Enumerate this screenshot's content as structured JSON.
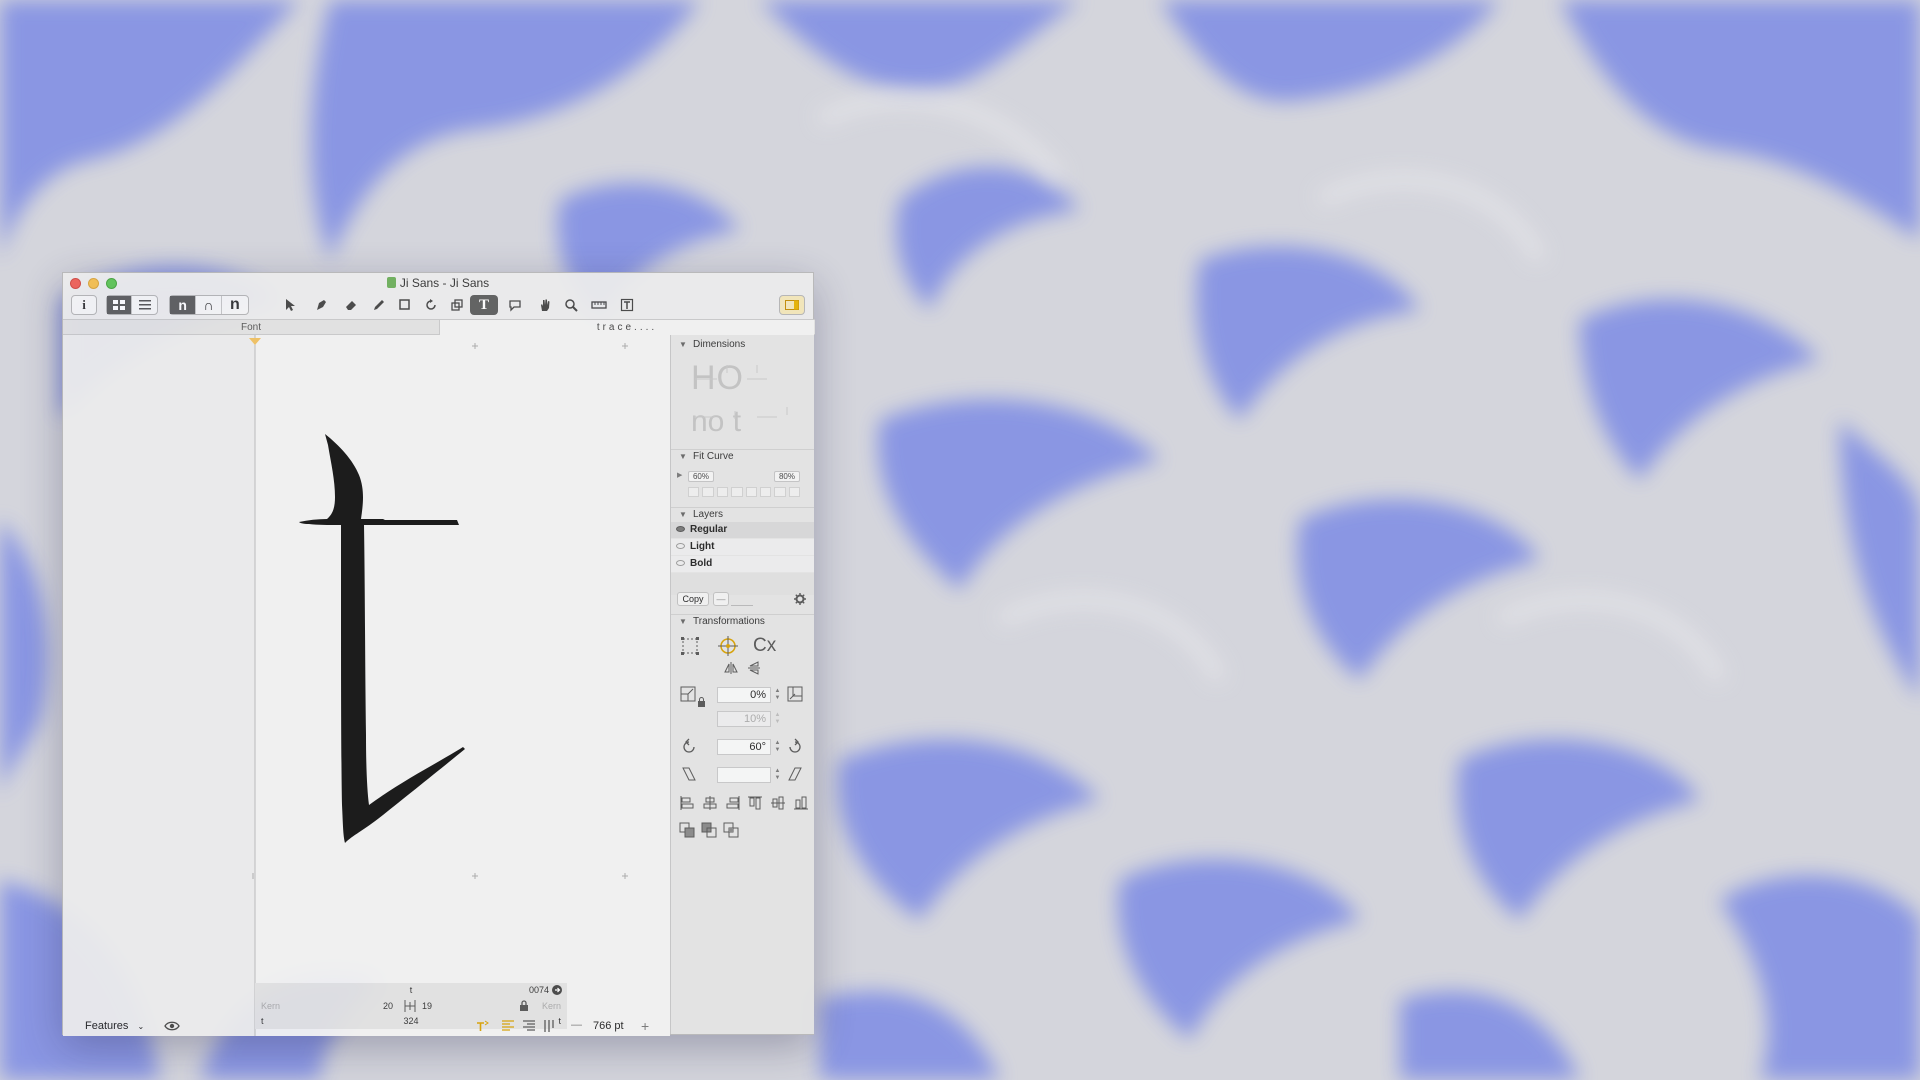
{
  "window": {
    "title": "Ji Sans - Ji Sans"
  },
  "tabs": {
    "font": "Font",
    "trace": "trace...."
  },
  "toolbar": {
    "info_icon": "i",
    "glyph_n_outline": "n",
    "glyph_n_thin": "∩",
    "glyph_n_bold": "n",
    "text_tool": "T"
  },
  "glyph": {
    "char": "t"
  },
  "dimensions": {
    "label": "Dimensions",
    "preview_top": "HO",
    "preview_bottom": "no t"
  },
  "fit_curve": {
    "label": "Fit Curve",
    "min": "60%",
    "max": "80%"
  },
  "layers": {
    "label": "Layers",
    "items": [
      {
        "name": "Regular",
        "visible": true
      },
      {
        "name": "Light",
        "visible": false
      },
      {
        "name": "Bold",
        "visible": false
      }
    ],
    "copy_label": "Copy",
    "minus_label": "—"
  },
  "transformations": {
    "label": "Transformations",
    "cx_label": "Cx",
    "scale_value": "0%",
    "scale_y_value": "10%",
    "rotate_value": "60°"
  },
  "info": {
    "glyph_name": "t",
    "unicode": "0074",
    "kern_left_label": "Kern",
    "kern_right_label": "Kern",
    "lsb": "20",
    "rsb": "19",
    "width": "324",
    "left_group": "t",
    "right_group": "t"
  },
  "bottombar": {
    "features_label": "Features",
    "zoom": "766 pt",
    "minus": "—",
    "plus": "+"
  },
  "colors": {
    "close": "#ee5f57",
    "minimize": "#f5bf4f",
    "maximize": "#5fc555",
    "wallpaper_blue": "#7b87e6",
    "wallpaper_gray": "#d6d6d9"
  }
}
